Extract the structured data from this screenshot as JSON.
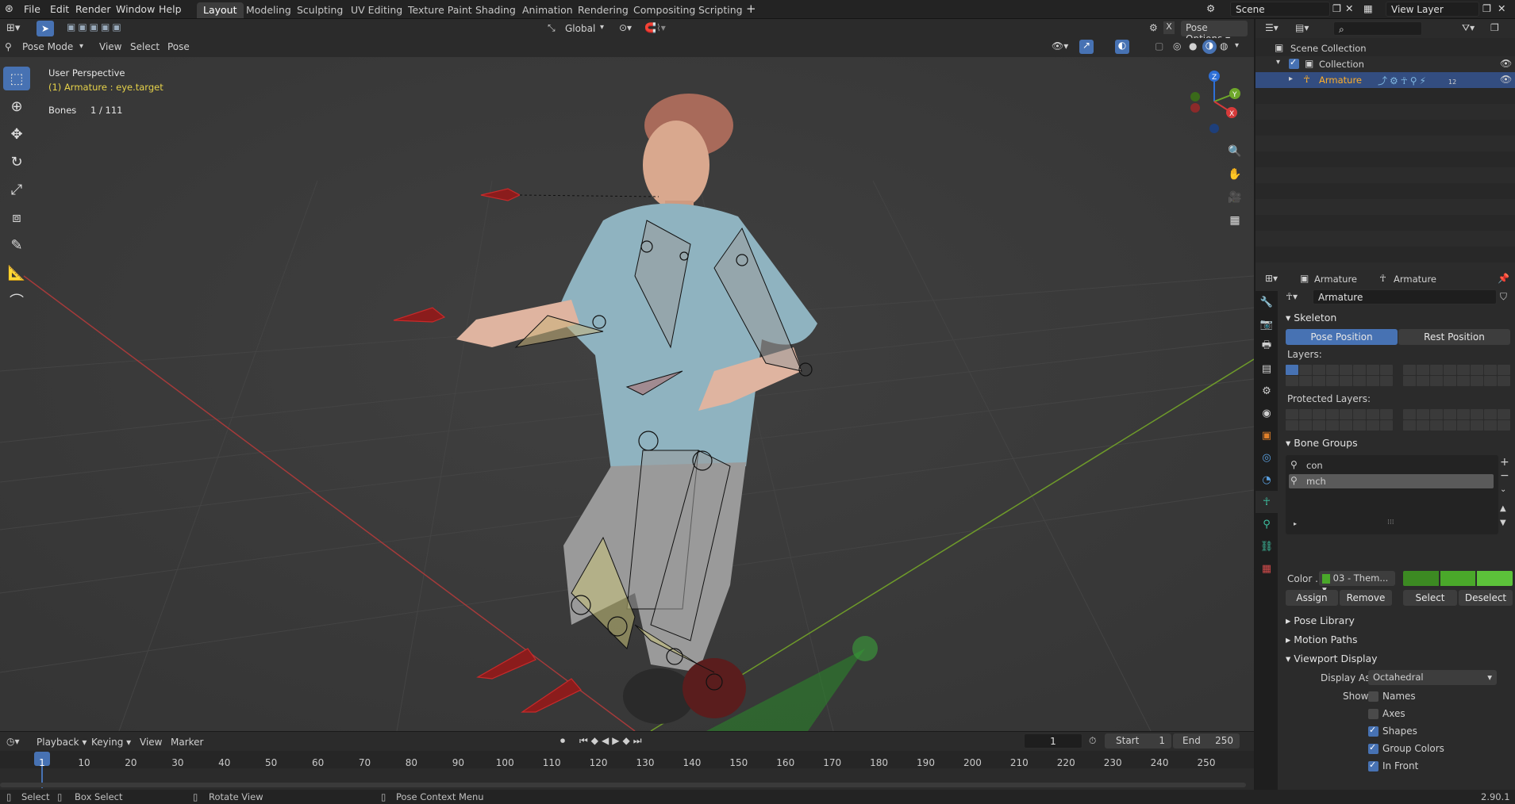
{
  "menu": [
    "File",
    "Edit",
    "Render",
    "Window",
    "Help"
  ],
  "workspaces": [
    "Layout",
    "Modeling",
    "Sculpting",
    "UV Editing",
    "Texture Paint",
    "Shading",
    "Animation",
    "Rendering",
    "Compositing",
    "Scripting"
  ],
  "scene_field": "Scene",
  "view_layer_field": "View Layer",
  "viewport_header": {
    "mode": "Pose Mode",
    "menus": [
      "View",
      "Select",
      "Pose"
    ],
    "orientation": "Global",
    "pose_options": "Pose Options"
  },
  "overlay_text": {
    "view_name": "User Perspective",
    "active": "(1) Armature : eye.target",
    "bones_label": "Bones",
    "bones_value": "1 / 111"
  },
  "axes_gizmo": {
    "z": "Z",
    "y": "Y",
    "x": "X"
  },
  "outliner": {
    "search_placeholder": "",
    "rows": [
      {
        "label": "Scene Collection"
      },
      {
        "label": "Collection"
      },
      {
        "label": "Armature"
      }
    ],
    "badge": "12"
  },
  "properties": {
    "header_object": "Armature",
    "header_data": "Armature",
    "name_field": "Armature",
    "skeleton": {
      "title": "Skeleton",
      "pose_position": "Pose Position",
      "rest_position": "Rest Position",
      "layers_label": "Layers:",
      "protected_label": "Protected Layers:"
    },
    "bone_groups": {
      "title": "Bone Groups",
      "items": [
        "con",
        "mch"
      ],
      "color_label": "Color ...",
      "color_set": "03 - Them...",
      "assign": "Assign",
      "remove": "Remove",
      "select": "Select",
      "deselect": "Deselect"
    },
    "collapsed_panels": [
      "Pose Library",
      "Motion Paths"
    ],
    "viewport_display": {
      "title": "Viewport Display",
      "display_as_label": "Display As",
      "display_as_value": "Octahedral",
      "show_label": "Show",
      "options": [
        {
          "label": "Names",
          "checked": false
        },
        {
          "label": "Axes",
          "checked": false
        },
        {
          "label": "Shapes",
          "checked": true
        },
        {
          "label": "Group Colors",
          "checked": true
        },
        {
          "label": "In Front",
          "checked": true
        }
      ]
    }
  },
  "timeline": {
    "menus": [
      "Playback",
      "Keying",
      "View",
      "Marker"
    ],
    "current_frame": "1",
    "start_label": "Start",
    "start_value": "1",
    "end_label": "End",
    "end_value": "250",
    "ticks": [
      "1",
      "10",
      "20",
      "30",
      "40",
      "50",
      "60",
      "70",
      "80",
      "90",
      "100",
      "110",
      "120",
      "130",
      "140",
      "150",
      "160",
      "170",
      "180",
      "190",
      "200",
      "210",
      "220",
      "230",
      "240",
      "250"
    ]
  },
  "statusbar": {
    "select": "Select",
    "box_select": "Box Select",
    "rotate_view": "Rotate View",
    "context_menu": "Pose Context Menu",
    "version": "2.90.1"
  },
  "colors": {
    "accent": "#4772b3",
    "selected_text": "#ffaf29",
    "overlay_active_text": "#e6d24a",
    "bone_group_green": "#4aa82a"
  }
}
